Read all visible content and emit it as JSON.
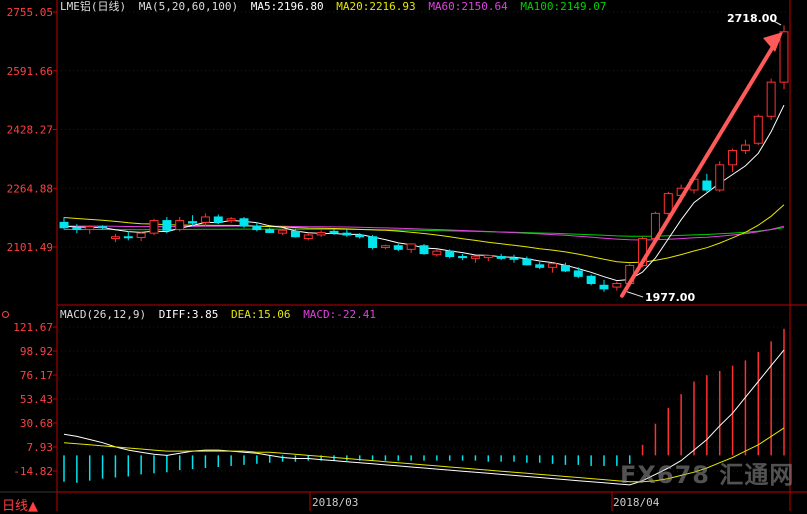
{
  "header": {
    "title": "LME铝(日线)",
    "ma_label": "MA(5,20,60,100)",
    "ma5": "MA5:2196.80",
    "ma20": "MA20:2216.93",
    "ma60": "MA60:2150.64",
    "ma100": "MA100:2149.07"
  },
  "macd_header": {
    "label": "MACD(26,12,9)",
    "diff": "DIFF:3.85",
    "dea": "DEA:15.06",
    "macd": "MACD:-22.41"
  },
  "annotations": {
    "high": "2718.00",
    "low": "1977.00"
  },
  "period_button": "日线▲",
  "watermark": "FX678 汇通网",
  "colors": {
    "up": "#ff3030",
    "down": "#00e5ee",
    "ma5": "#ffffff",
    "ma20": "#e6e600",
    "ma60": "#e040e0",
    "ma100": "#00d000",
    "arrow": "#ff5a5a",
    "axis": "#c00000"
  },
  "chart_data": [
    {
      "type": "candlestick",
      "y_ticks": [
        "2755.05",
        "2591.66",
        "2428.27",
        "2264.88",
        "2101.49"
      ],
      "ylim": [
        1950,
        2755.05
      ],
      "x_ticks": [
        "2018/03",
        "2018/04"
      ],
      "annotated_high": 2718.0,
      "annotated_low": 1977.0,
      "series": [
        {
          "name": "candles",
          "ohlc": [
            [
              2170,
              2185,
              2150,
              2155
            ],
            [
              2155,
              2165,
              2140,
              2150
            ],
            [
              2150,
              2162,
              2138,
              2158
            ],
            [
              2158,
              2162,
              2150,
              2155
            ],
            [
              2125,
              2138,
              2115,
              2130
            ],
            [
              2130,
              2145,
              2120,
              2128
            ],
            [
              2128,
              2145,
              2118,
              2140
            ],
            [
              2140,
              2180,
              2135,
              2175
            ],
            [
              2175,
              2185,
              2140,
              2148
            ],
            [
              2150,
              2185,
              2145,
              2175
            ],
            [
              2172,
              2190,
              2160,
              2168
            ],
            [
              2170,
              2195,
              2160,
              2185
            ],
            [
              2185,
              2192,
              2165,
              2170
            ],
            [
              2175,
              2185,
              2168,
              2180
            ],
            [
              2180,
              2185,
              2155,
              2160
            ],
            [
              2160,
              2170,
              2145,
              2150
            ],
            [
              2150,
              2155,
              2140,
              2142
            ],
            [
              2140,
              2152,
              2135,
              2148
            ],
            [
              2145,
              2152,
              2128,
              2130
            ],
            [
              2125,
              2140,
              2120,
              2135
            ],
            [
              2135,
              2148,
              2130,
              2142
            ],
            [
              2145,
              2152,
              2135,
              2140
            ],
            [
              2140,
              2150,
              2130,
              2135
            ],
            [
              2135,
              2140,
              2125,
              2130
            ],
            [
              2130,
              2135,
              2095,
              2100
            ],
            [
              2100,
              2108,
              2095,
              2105
            ],
            [
              2105,
              2110,
              2090,
              2095
            ],
            [
              2095,
              2112,
              2085,
              2110
            ],
            [
              2105,
              2110,
              2080,
              2083
            ],
            [
              2080,
              2095,
              2075,
              2090
            ],
            [
              2090,
              2095,
              2070,
              2075
            ],
            [
              2075,
              2082,
              2065,
              2072
            ],
            [
              2070,
              2078,
              2058,
              2076
            ],
            [
              2072,
              2080,
              2062,
              2078
            ],
            [
              2075,
              2082,
              2065,
              2070
            ],
            [
              2070,
              2080,
              2058,
              2068
            ],
            [
              2068,
              2075,
              2050,
              2052
            ],
            [
              2052,
              2060,
              2040,
              2045
            ],
            [
              2045,
              2058,
              2030,
              2055
            ],
            [
              2050,
              2058,
              2032,
              2035
            ],
            [
              2035,
              2045,
              2015,
              2020
            ],
            [
              2020,
              2025,
              1995,
              2000
            ],
            [
              1995,
              2010,
              1977,
              1985
            ],
            [
              1990,
              2005,
              1980,
              2000
            ],
            [
              2000,
              2055,
              1995,
              2050
            ],
            [
              2050,
              2130,
              2045,
              2125
            ],
            [
              2125,
              2200,
              2120,
              2195
            ],
            [
              2195,
              2255,
              2185,
              2250
            ],
            [
              2245,
              2275,
              2225,
              2265
            ],
            [
              2260,
              2295,
              2250,
              2290
            ],
            [
              2285,
              2305,
              2255,
              2260
            ],
            [
              2260,
              2340,
              2255,
              2330
            ],
            [
              2330,
              2375,
              2310,
              2370
            ],
            [
              2370,
              2400,
              2360,
              2385
            ],
            [
              2390,
              2470,
              2385,
              2465
            ],
            [
              2465,
              2570,
              2455,
              2560
            ],
            [
              2560,
              2718,
              2540,
              2700
            ]
          ]
        },
        {
          "name": "MA5",
          "values": [
            2196.8
          ]
        },
        {
          "name": "MA20",
          "values": [
            2216.93
          ]
        },
        {
          "name": "MA60",
          "values": [
            2150.64
          ]
        },
        {
          "name": "MA100",
          "values": [
            2149.07
          ]
        }
      ]
    },
    {
      "type": "bar",
      "y_ticks": [
        "121.67",
        "98.92",
        "76.17",
        "53.43",
        "30.68",
        "7.93",
        "-14.82"
      ],
      "ylim": [
        -30,
        127
      ],
      "series": [
        {
          "name": "MACD",
          "values": [
            -25,
            -26,
            -24,
            -22,
            -21,
            -20,
            -18,
            -17,
            -16,
            -14,
            -13,
            -12,
            -11,
            -10,
            -9,
            -8,
            -7,
            -6,
            -6,
            -5,
            -5,
            -5,
            -5,
            -5,
            -5,
            -5,
            -5,
            -5,
            -5,
            -5,
            -5,
            -5,
            -5,
            -6,
            -6,
            -6,
            -7,
            -7,
            -8,
            -9,
            -9,
            -10,
            -10,
            -10,
            -8,
            10,
            30,
            45,
            58,
            70,
            76,
            80,
            85,
            90,
            98,
            108,
            120
          ]
        },
        {
          "name": "DIFF",
          "values": [
            20,
            18,
            15,
            12,
            8,
            5,
            3,
            1,
            0,
            2,
            4,
            5,
            5,
            4,
            3,
            2,
            0,
            -2,
            -3,
            -3,
            -4,
            -5,
            -6,
            -7,
            -8,
            -9,
            -10,
            -11,
            -12,
            -13,
            -14,
            -15,
            -16,
            -17,
            -18,
            -19,
            -20,
            -21,
            -22,
            -23,
            -24,
            -25,
            -26,
            -27,
            -28,
            -24,
            -18,
            -12,
            -5,
            5,
            15,
            28,
            40,
            55,
            70,
            85,
            100
          ]
        },
        {
          "name": "DEA",
          "values": [
            12,
            11,
            10,
            9,
            8,
            7,
            6,
            5,
            4,
            4,
            4,
            4,
            4,
            4,
            4,
            3,
            3,
            2,
            1,
            0,
            -1,
            -2,
            -3,
            -4,
            -5,
            -6,
            -7,
            -8,
            -9,
            -10,
            -11,
            -12,
            -13,
            -14,
            -15,
            -16,
            -17,
            -18,
            -19,
            -20,
            -21,
            -22,
            -23,
            -24,
            -25,
            -25,
            -24,
            -22,
            -19,
            -16,
            -12,
            -7,
            -2,
            4,
            10,
            18,
            26
          ]
        }
      ]
    }
  ]
}
